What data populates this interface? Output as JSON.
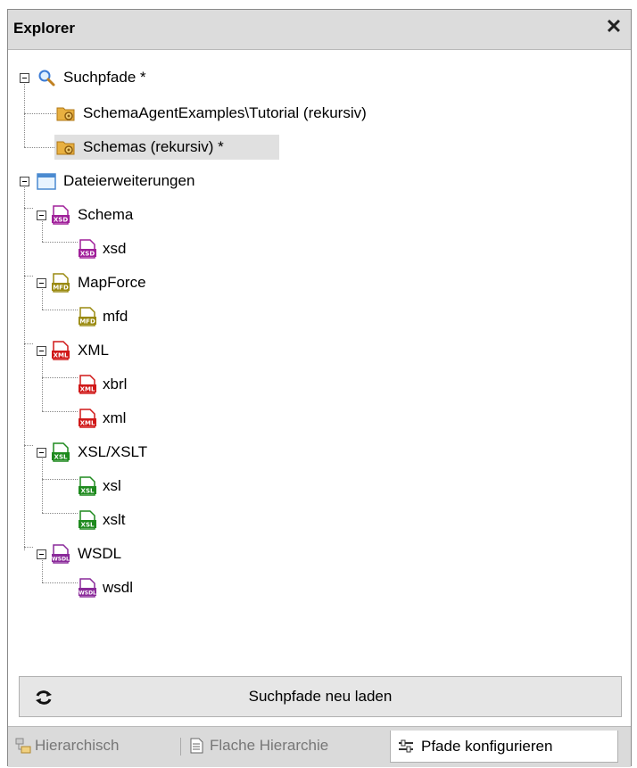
{
  "window": {
    "title": "Explorer",
    "close_label": "✕"
  },
  "tree": {
    "search_paths": {
      "label": "Suchpfade *",
      "children": [
        {
          "label": "SchemaAgentExamples\\Tutorial (rekursiv)"
        },
        {
          "label": "Schemas (rekursiv) *"
        }
      ]
    },
    "extensions": {
      "label": "Dateierweiterungen",
      "groups": [
        {
          "label": "Schema",
          "badge": "XSD",
          "children": [
            "xsd"
          ]
        },
        {
          "label": "MapForce",
          "badge": "MFD",
          "children": [
            "mfd"
          ]
        },
        {
          "label": "XML",
          "badge": "XML",
          "children": [
            "xbrl",
            "xml"
          ]
        },
        {
          "label": "XSL/XSLT",
          "badge": "XSL",
          "children": [
            "xsl",
            "xslt"
          ]
        },
        {
          "label": "WSDL",
          "badge": "WSDL",
          "children": [
            "wsdl"
          ]
        }
      ]
    }
  },
  "reload_button": {
    "label": "Suchpfade neu laden"
  },
  "tabs": [
    {
      "label": "Hierarchisch"
    },
    {
      "label": "Flache Hierarchie"
    },
    {
      "label": "Pfade konfigurieren"
    }
  ],
  "colors": {
    "xsd": "#a0209a",
    "mfd": "#9a8a10",
    "xml": "#d01818",
    "xsl": "#1e8a1e",
    "wsdl": "#8a2a9a",
    "folder": "#e8b040"
  }
}
